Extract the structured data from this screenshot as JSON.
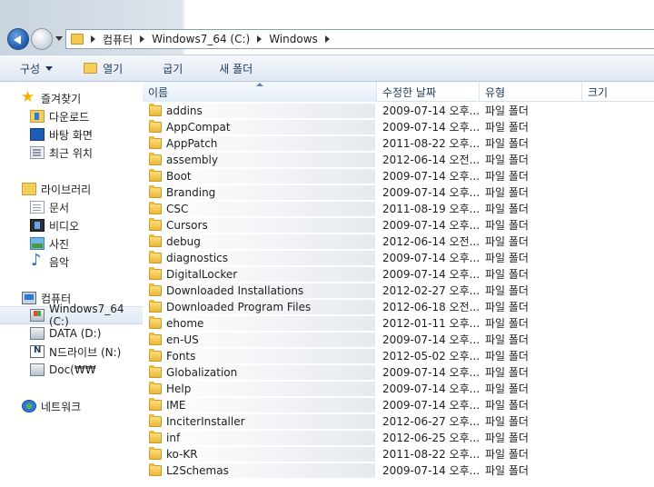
{
  "address": {
    "segments": [
      "컴퓨터",
      "Windows7_64 (C:)",
      "Windows"
    ]
  },
  "toolbar": {
    "organize": "구성",
    "open": "열기",
    "share": "굽기",
    "new_folder": "새 폴더"
  },
  "nav": {
    "favorites": "즐겨찾기",
    "downloads": "다운로드",
    "desktop": "바탕 화면",
    "recent": "최근 위치",
    "libraries": "라이브러리",
    "documents": "문서",
    "videos": "비디오",
    "pictures": "사진",
    "music": "음악",
    "computer": "컴퓨터",
    "drive_c": "Windows7_64 (C:)",
    "drive_d": "DATA (D:)",
    "drive_n": "N드라이브 (N:)",
    "drive_doc": "Doc(₩₩",
    "network": "네트워크"
  },
  "columns": {
    "name": "이름",
    "date": "수정한 날짜",
    "type": "유형",
    "size": "크기"
  },
  "files": [
    {
      "name": "addins",
      "date": "2009-07-14 오후...",
      "type": "파일 폴더"
    },
    {
      "name": "AppCompat",
      "date": "2009-07-14 오후...",
      "type": "파일 폴더"
    },
    {
      "name": "AppPatch",
      "date": "2011-08-22 오후...",
      "type": "파일 폴더"
    },
    {
      "name": "assembly",
      "date": "2012-06-14 오전...",
      "type": "파일 폴더"
    },
    {
      "name": "Boot",
      "date": "2009-07-14 오후...",
      "type": "파일 폴더"
    },
    {
      "name": "Branding",
      "date": "2009-07-14 오후...",
      "type": "파일 폴더"
    },
    {
      "name": "CSC",
      "date": "2011-08-19 오후...",
      "type": "파일 폴더"
    },
    {
      "name": "Cursors",
      "date": "2009-07-14 오후...",
      "type": "파일 폴더"
    },
    {
      "name": "debug",
      "date": "2012-06-14 오전...",
      "type": "파일 폴더"
    },
    {
      "name": "diagnostics",
      "date": "2009-07-14 오후...",
      "type": "파일 폴더"
    },
    {
      "name": "DigitalLocker",
      "date": "2009-07-14 오후...",
      "type": "파일 폴더"
    },
    {
      "name": "Downloaded Installations",
      "date": "2012-02-27 오후...",
      "type": "파일 폴더"
    },
    {
      "name": "Downloaded Program Files",
      "date": "2012-06-18 오전...",
      "type": "파일 폴더"
    },
    {
      "name": "ehome",
      "date": "2012-01-11 오후...",
      "type": "파일 폴더"
    },
    {
      "name": "en-US",
      "date": "2009-07-14 오후...",
      "type": "파일 폴더"
    },
    {
      "name": "Fonts",
      "date": "2012-05-02 오후...",
      "type": "파일 폴더"
    },
    {
      "name": "Globalization",
      "date": "2009-07-14 오후...",
      "type": "파일 폴더"
    },
    {
      "name": "Help",
      "date": "2009-07-14 오후...",
      "type": "파일 폴더"
    },
    {
      "name": "IME",
      "date": "2009-07-14 오후...",
      "type": "파일 폴더"
    },
    {
      "name": "InciterInstaller",
      "date": "2012-06-27 오후...",
      "type": "파일 폴더"
    },
    {
      "name": "inf",
      "date": "2012-06-25 오후...",
      "type": "파일 폴더"
    },
    {
      "name": "ko-KR",
      "date": "2011-08-22 오후...",
      "type": "파일 폴더"
    },
    {
      "name": "L2Schemas",
      "date": "2009-07-14 오후...",
      "type": "파일 폴더"
    }
  ]
}
